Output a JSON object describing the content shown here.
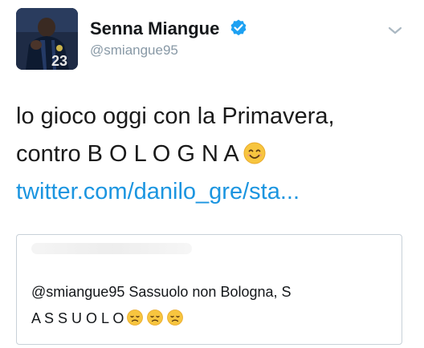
{
  "tweet": {
    "author": {
      "display_name": "Senna Miangue",
      "handle": "@smiangue95",
      "verified_icon": "verified-badge-icon",
      "avatar_jersey_number": "23"
    },
    "text_line1": "lo gioco oggi con la Primavera,",
    "text_line2": "contro B O L O G N A",
    "link": "twitter.com/danilo_gre/sta...",
    "emoji": "smiling-face-emoji"
  },
  "quote": {
    "mention": "@smiangue95",
    "text_line1_rest": "Sassuolo non Bologna, S",
    "text_line2": "A S S U O L O",
    "emoji": "disappointed-face-emoji",
    "emoji_count": 3
  },
  "colors": {
    "link": "#1b95e0",
    "handle": "#8899a6",
    "verified": "#1da1f2",
    "border": "#c8d1d8"
  }
}
